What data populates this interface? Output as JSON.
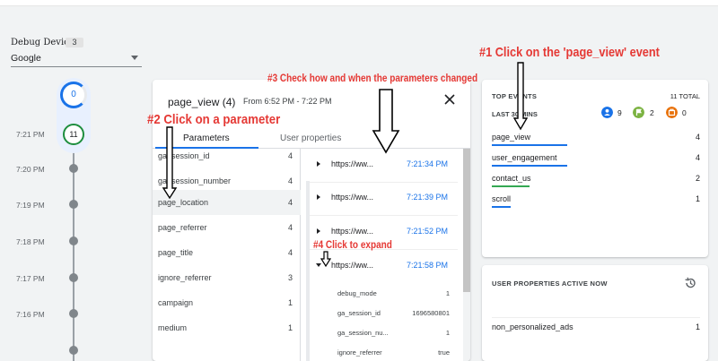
{
  "debug": {
    "label": "Debug Device",
    "count": "3",
    "device": "Google"
  },
  "timeline": {
    "top_count": "0",
    "current_count": "11",
    "current_time": "7:21 PM",
    "times": [
      "7:20 PM",
      "7:19 PM",
      "7:18 PM",
      "7:17 PM",
      "7:16 PM"
    ]
  },
  "event_panel": {
    "title": "page_view (4)",
    "range": "From 6:52 PM - 7:22 PM",
    "tabs": {
      "params": "Parameters",
      "user_props": "User properties"
    },
    "params": [
      {
        "name": "ga_session_id",
        "count": "4"
      },
      {
        "name": "ga_session_number",
        "count": "4"
      },
      {
        "name": "page_location",
        "count": "4"
      },
      {
        "name": "page_referrer",
        "count": "4"
      },
      {
        "name": "page_title",
        "count": "4"
      },
      {
        "name": "ignore_referrer",
        "count": "3"
      },
      {
        "name": "campaign",
        "count": "1"
      },
      {
        "name": "medium",
        "count": "1"
      }
    ],
    "values": [
      {
        "url": "https://ww...",
        "time": "7:21:34 PM"
      },
      {
        "url": "https://ww...",
        "time": "7:21:39 PM"
      },
      {
        "url": "https://ww...",
        "time": "7:21:52 PM"
      },
      {
        "url": "https://ww...",
        "time": "7:21:58 PM"
      }
    ],
    "sub": [
      {
        "key": "debug_mode",
        "value": "1"
      },
      {
        "key": "ga_session_id",
        "value": "1696580801"
      },
      {
        "key": "ga_session_nu...",
        "value": "1"
      },
      {
        "key": "ignore_referrer",
        "value": "true"
      }
    ]
  },
  "top_events": {
    "heading": "TOP EVENTS",
    "total": "11 TOTAL",
    "window": "LAST 30 MINS",
    "badges": [
      {
        "icon": "person-icon",
        "color": "#1a73e8",
        "count": "9"
      },
      {
        "icon": "flag-icon",
        "color": "#34a853",
        "count": "2"
      },
      {
        "icon": "conversion-icon",
        "color": "#e8710a",
        "count": "0"
      }
    ],
    "events": [
      {
        "name": "page_view",
        "count": "4",
        "share": 1.0,
        "color": "#1a73e8"
      },
      {
        "name": "user_engagement",
        "count": "4",
        "share": 1.0,
        "color": "#1a73e8"
      },
      {
        "name": "contact_us",
        "count": "2",
        "share": 0.5,
        "color": "#34a853"
      },
      {
        "name": "scroll",
        "count": "1",
        "share": 0.25,
        "color": "#1a73e8"
      }
    ]
  },
  "user_properties": {
    "heading": "USER PROPERTIES ACTIVE NOW",
    "items": [
      {
        "name": "non_personalized_ads",
        "count": "1"
      }
    ]
  },
  "annotations": {
    "a1": "#1 Click on the 'page_view' event",
    "a2": "#2 Click on a parameter",
    "a3": "#3 Check how and when the parameters changed",
    "a4": "#4 Click to expand"
  }
}
